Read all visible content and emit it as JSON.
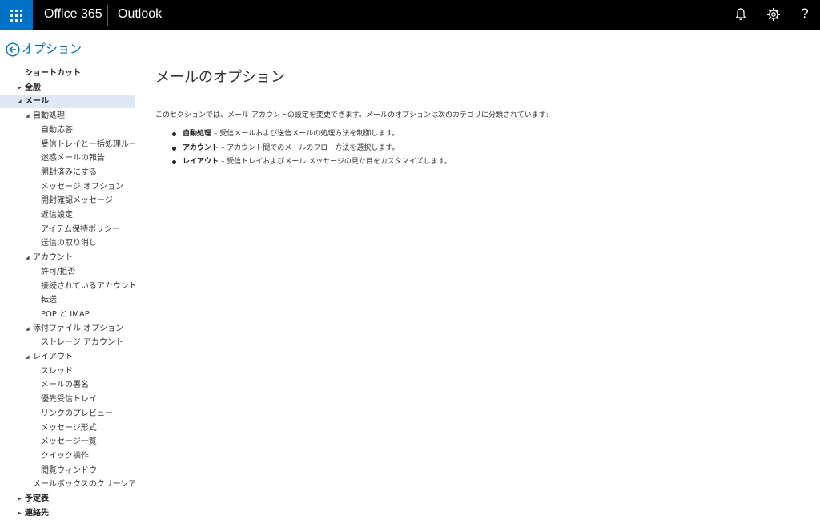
{
  "topbar": {
    "brand": "Office 365",
    "app": "Outlook",
    "icons": [
      "app-launcher-icon",
      "bell-icon",
      "gear-icon",
      "help-icon"
    ],
    "help_label": "?",
    "accent": "#0072c6",
    "background": "#000000"
  },
  "options": {
    "title": "オプション"
  },
  "sidebar": {
    "items": [
      {
        "label": "ショートカット",
        "level": 0,
        "toggle": ""
      },
      {
        "label": "全般",
        "level": 0,
        "toggle": "▶"
      },
      {
        "label": "メール",
        "level": 0,
        "toggle": "◢",
        "selected": true
      },
      {
        "label": "自動処理",
        "level": 1,
        "toggle": "◢"
      },
      {
        "label": "自動応答",
        "level": 2,
        "toggle": ""
      },
      {
        "label": "受信トレイと一括処理ルール",
        "level": 2,
        "toggle": ""
      },
      {
        "label": "迷惑メールの報告",
        "level": 2,
        "toggle": ""
      },
      {
        "label": "開封済みにする",
        "level": 2,
        "toggle": ""
      },
      {
        "label": "メッセージ オプション",
        "level": 2,
        "toggle": ""
      },
      {
        "label": "開封確認メッセージ",
        "level": 2,
        "toggle": ""
      },
      {
        "label": "返信設定",
        "level": 2,
        "toggle": ""
      },
      {
        "label": "アイテム保持ポリシー",
        "level": 2,
        "toggle": ""
      },
      {
        "label": "送信の取り消し",
        "level": 2,
        "toggle": ""
      },
      {
        "label": "アカウント",
        "level": 1,
        "toggle": "◢"
      },
      {
        "label": "許可/拒否",
        "level": 2,
        "toggle": ""
      },
      {
        "label": "接続されているアカウント",
        "level": 2,
        "toggle": ""
      },
      {
        "label": "転送",
        "level": 2,
        "toggle": ""
      },
      {
        "label": "POP と IMAP",
        "level": 2,
        "toggle": ""
      },
      {
        "label": "添付ファイル オプション",
        "level": 1,
        "toggle": "◢"
      },
      {
        "label": "ストレージ アカウント",
        "level": 2,
        "toggle": ""
      },
      {
        "label": "レイアウト",
        "level": 1,
        "toggle": "◢"
      },
      {
        "label": "スレッド",
        "level": 2,
        "toggle": ""
      },
      {
        "label": "メールの署名",
        "level": 2,
        "toggle": ""
      },
      {
        "label": "優先受信トレイ",
        "level": 2,
        "toggle": ""
      },
      {
        "label": "リンクのプレビュー",
        "level": 2,
        "toggle": ""
      },
      {
        "label": "メッセージ形式",
        "level": 2,
        "toggle": ""
      },
      {
        "label": "メッセージ一覧",
        "level": 2,
        "toggle": ""
      },
      {
        "label": "クイック操作",
        "level": 2,
        "toggle": ""
      },
      {
        "label": "閲覧ウィンドウ",
        "level": 2,
        "toggle": ""
      },
      {
        "label": "メールボックスのクリーンアップ",
        "level": 1,
        "toggle": ""
      },
      {
        "label": "予定表",
        "level": 0,
        "toggle": "▶"
      },
      {
        "label": "連絡先",
        "level": 0,
        "toggle": "▶"
      }
    ]
  },
  "main": {
    "title": "メールのオプション",
    "intro": "このセクションでは、メール アカウントの設定を変更できます。メールのオプションは次のカテゴリに分類されています:",
    "categories": [
      {
        "name": "自動処理",
        "desc": " – 受信メールおよび送信メールの処理方法を制御します。"
      },
      {
        "name": "アカウント",
        "desc": " – アカウント間でのメールのフロー方法を選択します。"
      },
      {
        "name": "レイアウト",
        "desc": " – 受信トレイおよびメール メッセージの見た目をカスタマイズします。"
      }
    ]
  }
}
